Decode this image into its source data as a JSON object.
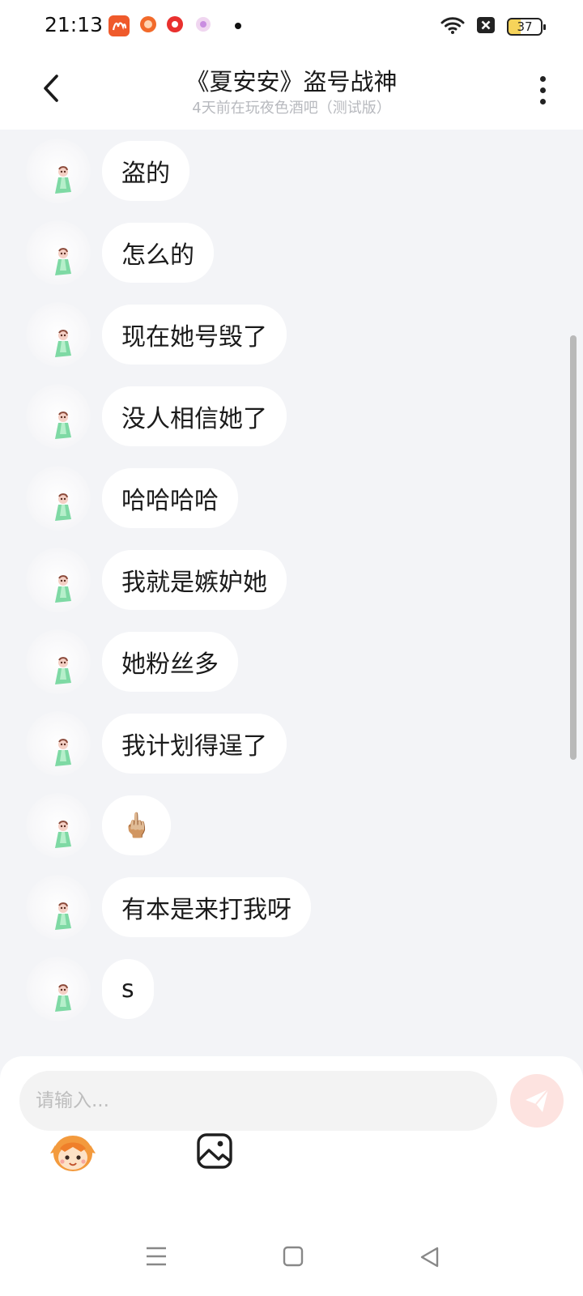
{
  "status_bar": {
    "time": "21:13",
    "battery": "37"
  },
  "header": {
    "title": "《夏安安》盗号战神",
    "subtitle": "4天前在玩夜色酒吧（测试版）"
  },
  "messages": [
    {
      "text": "盗的"
    },
    {
      "text": "怎么的"
    },
    {
      "text": "现在她号毁了"
    },
    {
      "text": "没人相信她了"
    },
    {
      "text": "哈哈哈哈"
    },
    {
      "text": "我就是嫉妒她"
    },
    {
      "text": "她粉丝多"
    },
    {
      "text": "我计划得逞了"
    },
    {
      "text": "🖕🏼"
    },
    {
      "text": "有本是来打我呀"
    },
    {
      "text": "s"
    }
  ],
  "composer": {
    "placeholder": "请输入..."
  },
  "icons": {
    "back": "back-arrow-icon",
    "more": "more-vertical-icon",
    "send": "send-icon",
    "avatar_sticker": "character-avatar-icon",
    "image": "image-icon",
    "nav_menu": "menu-icon",
    "nav_home": "home-icon",
    "nav_back": "nav-back-icon"
  },
  "colors": {
    "background": "#f3f4f7",
    "bubble": "#ffffff",
    "send_button": "#fde3e0",
    "avatar_accent_green": "#7ed9a4"
  }
}
